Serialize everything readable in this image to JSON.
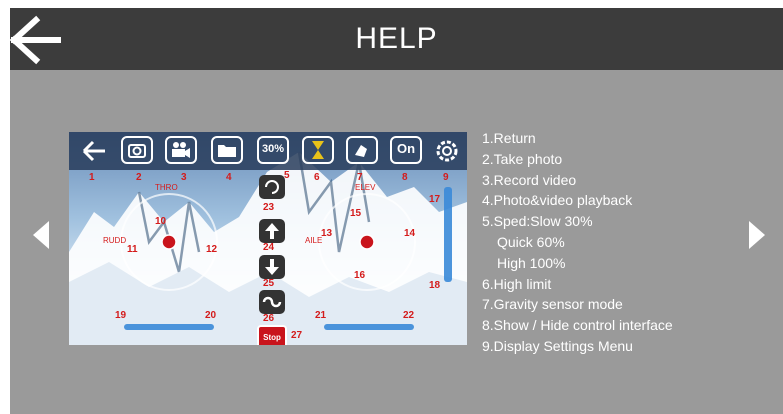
{
  "header": {
    "title": "HELP"
  },
  "diagram": {
    "speed_badge": "30%",
    "toggle_badge": "On",
    "stop_label": "Stop",
    "stick_labels": {
      "thro": "THRO",
      "rudd": "RUDD",
      "elev": "ELEV",
      "aile": "AILE"
    },
    "numbers": [
      "1",
      "2",
      "3",
      "4",
      "5",
      "6",
      "7",
      "8",
      "9",
      "10",
      "11",
      "12",
      "13",
      "14",
      "15",
      "16",
      "17",
      "18",
      "19",
      "20",
      "21",
      "22",
      "23",
      "24",
      "25",
      "26",
      "27"
    ]
  },
  "legend": [
    "1.Return",
    "2.Take photo",
    "3.Record video",
    "4.Photo&video playback",
    "5.Sped:Slow 30%",
    "Quick 60%",
    "High 100%",
    "6.High limit",
    "7.Gravity sensor mode",
    "8.Show / Hide control interface",
    "9.Display Settings Menu"
  ],
  "icons": {
    "back": "arrow-left-icon",
    "prev": "triangle-left-icon",
    "next": "triangle-right-icon"
  }
}
